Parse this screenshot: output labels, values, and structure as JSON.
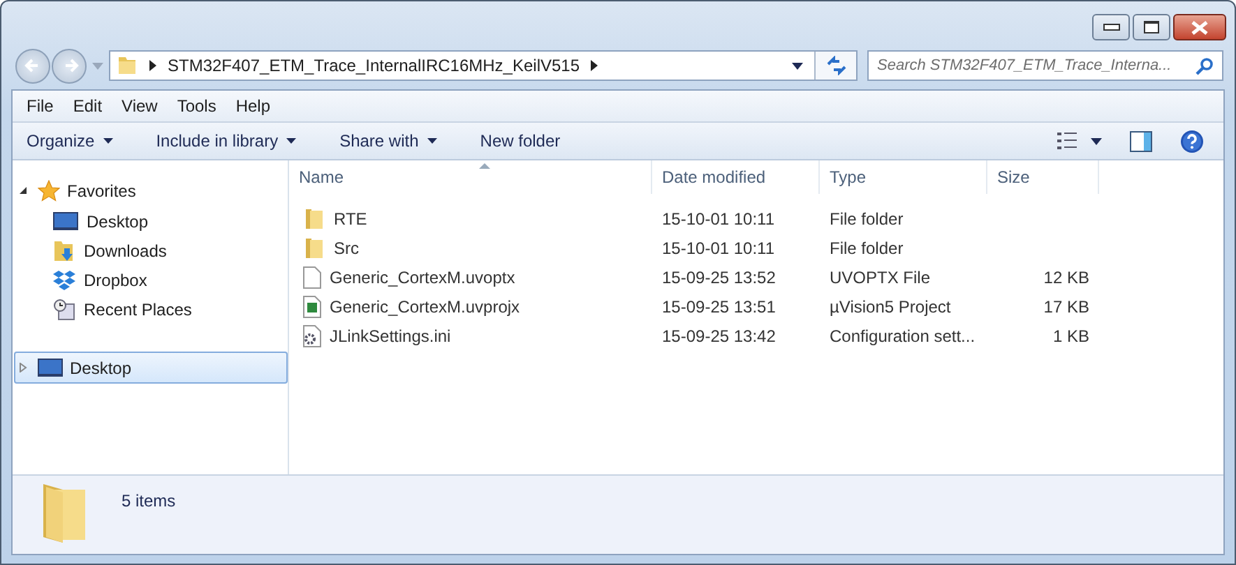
{
  "address": {
    "path": "STM32F407_ETM_Trace_InternalIRC16MHz_KeilV515"
  },
  "search": {
    "placeholder": "Search STM32F407_ETM_Trace_Interna..."
  },
  "menu": [
    "File",
    "Edit",
    "View",
    "Tools",
    "Help"
  ],
  "toolbar": [
    {
      "label": "Organize",
      "dropdown": true
    },
    {
      "label": "Include in library",
      "dropdown": true
    },
    {
      "label": "Share with",
      "dropdown": true
    },
    {
      "label": "New folder",
      "dropdown": false
    }
  ],
  "sidebar": {
    "groups": [
      {
        "label": "Favorites",
        "expanded": true,
        "selected": false,
        "kind": "star",
        "children": [
          {
            "label": "Desktop",
            "kind": "desktop"
          },
          {
            "label": "Downloads",
            "kind": "downloads"
          },
          {
            "label": "Dropbox",
            "kind": "dropbox"
          },
          {
            "label": "Recent Places",
            "kind": "recent"
          }
        ]
      },
      {
        "label": "Desktop",
        "expanded": false,
        "selected": true,
        "kind": "desktop"
      }
    ]
  },
  "table": {
    "columns": [
      "Name",
      "Date modified",
      "Type",
      "Size"
    ],
    "rows": [
      {
        "name": "RTE",
        "date": "15-10-01 10:11",
        "type": "File folder",
        "kind": "folder"
      },
      {
        "name": "Src",
        "date": "15-10-01 10:11",
        "type": "File folder",
        "kind": "folder"
      },
      {
        "name": "Generic_CortexM.uvoptx",
        "date": "15-09-25 13:52",
        "type": "UVOPTX File",
        "size": "12 KB",
        "kind": "file"
      },
      {
        "name": "Generic_CortexM.uvprojx",
        "date": "15-09-25 13:51",
        "type": "µVision5 Project",
        "size": "17 KB",
        "kind": "project"
      },
      {
        "name": "JLinkSettings.ini",
        "date": "15-09-25 13:42",
        "type": "Configuration sett...",
        "size": "1 KB",
        "kind": "settings"
      }
    ]
  },
  "status_bar": {
    "count": "5 items"
  }
}
